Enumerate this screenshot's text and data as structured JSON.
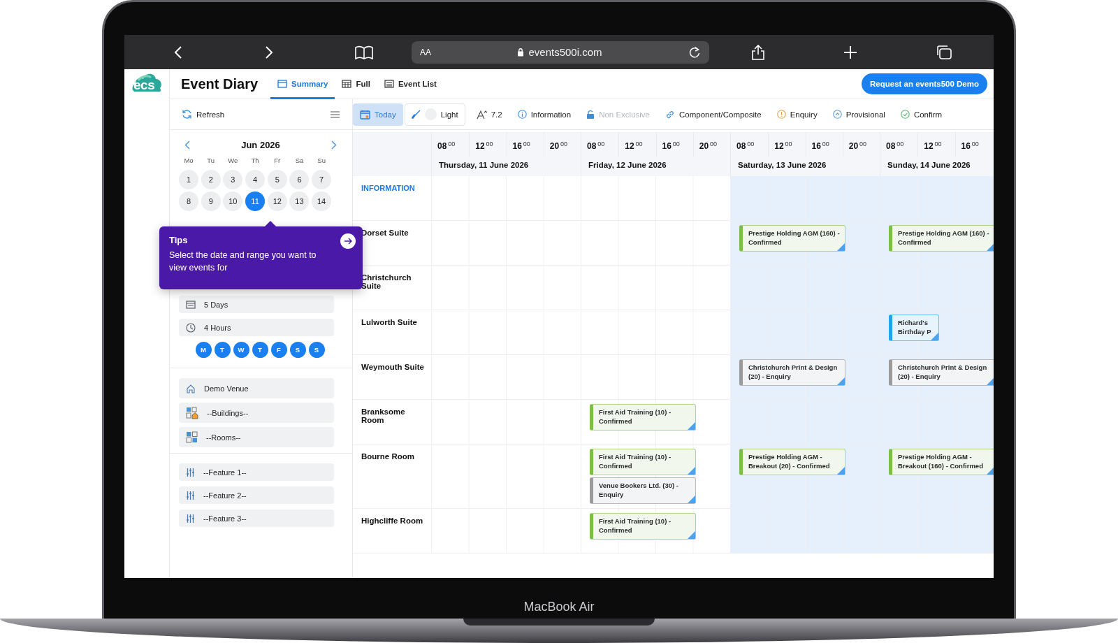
{
  "browser": {
    "text_size": "AA",
    "url": "events500i.com"
  },
  "logo": {
    "text": "ecs"
  },
  "header": {
    "title": "Event Diary",
    "tabs": [
      {
        "label": "Summary",
        "selected": true
      },
      {
        "label": "Full",
        "selected": false
      },
      {
        "label": "Event List",
        "selected": false
      }
    ],
    "demo_button": "Request an events500 Demo"
  },
  "sidebar": {
    "refresh": "Refresh",
    "calendar": {
      "month": "Jun 2026",
      "weekdays": [
        "Mo",
        "Tu",
        "We",
        "Th",
        "Fr",
        "Sa",
        "Su"
      ],
      "days": [
        {
          "label": "1",
          "selected": false
        },
        {
          "label": "2",
          "selected": false
        },
        {
          "label": "3",
          "selected": false
        },
        {
          "label": "4",
          "selected": false
        },
        {
          "label": "5",
          "selected": false
        },
        {
          "label": "6",
          "selected": false
        },
        {
          "label": "7",
          "selected": false
        },
        {
          "label": "8",
          "selected": false
        },
        {
          "label": "9",
          "selected": false
        },
        {
          "label": "10",
          "selected": false
        },
        {
          "label": "11",
          "selected": true
        },
        {
          "label": "12",
          "selected": false
        },
        {
          "label": "13",
          "selected": false
        },
        {
          "label": "14",
          "selected": false
        }
      ]
    },
    "tips": {
      "title": "Tips",
      "text": "Select the date and range you want to view events for"
    },
    "range": [
      {
        "kind": "days",
        "label": "5 Days"
      },
      {
        "kind": "hours",
        "label": "4 Hours"
      }
    ],
    "weekday_filter": [
      {
        "label": "M",
        "selected": true
      },
      {
        "label": "T",
        "selected": true
      },
      {
        "label": "W",
        "selected": true
      },
      {
        "label": "T",
        "selected": true
      },
      {
        "label": "F",
        "selected": true
      },
      {
        "label": "S",
        "selected": true
      },
      {
        "label": "S",
        "selected": true
      }
    ],
    "venue_filters": [
      {
        "kind": "venue",
        "label": "Demo Venue"
      },
      {
        "kind": "buildings",
        "label": "--Buildings--"
      },
      {
        "kind": "rooms",
        "label": "--Rooms--"
      }
    ],
    "feature_filters": [
      {
        "label": "--Feature 1--"
      },
      {
        "label": "--Feature 2--"
      },
      {
        "label": "--Feature 3--"
      }
    ]
  },
  "toolbar": [
    {
      "kind": "today",
      "label": "Today",
      "selected": true,
      "disabled": false
    },
    {
      "kind": "theme",
      "label": "Light",
      "on": false,
      "selected": false,
      "disabled": false
    },
    {
      "kind": "font",
      "label": "7.2",
      "selected": false,
      "disabled": false
    },
    {
      "kind": "information",
      "label": "Information",
      "selected": false,
      "disabled": false
    },
    {
      "kind": "non-exclusive",
      "label": "Non Exclusive",
      "selected": false,
      "disabled": true
    },
    {
      "kind": "component",
      "label": "Component/Composite",
      "selected": false,
      "disabled": false
    },
    {
      "kind": "enquiry",
      "label": "Enquiry",
      "selected": false,
      "disabled": false
    },
    {
      "kind": "provisional",
      "label": "Provisional",
      "selected": false,
      "disabled": false
    },
    {
      "kind": "confirm",
      "label": "Confirm",
      "selected": false,
      "disabled": false
    }
  ],
  "timeline": {
    "days": [
      {
        "date": "Thursday, 11 June 2026",
        "shaded": false,
        "hours": [
          {
            "hour": "08",
            "minutes": "00"
          },
          {
            "hour": "12",
            "minutes": "00"
          },
          {
            "hour": "16",
            "minutes": "00"
          },
          {
            "hour": "20",
            "minutes": "00"
          }
        ]
      },
      {
        "date": "Friday, 12 June 2026",
        "shaded": false,
        "hours": [
          {
            "hour": "08",
            "minutes": "00"
          },
          {
            "hour": "12",
            "minutes": "00"
          },
          {
            "hour": "16",
            "minutes": "00"
          },
          {
            "hour": "20",
            "minutes": "00"
          }
        ]
      },
      {
        "date": "Saturday, 13 June 2026",
        "shaded": true,
        "hours": [
          {
            "hour": "08",
            "minutes": "00"
          },
          {
            "hour": "12",
            "minutes": "00"
          },
          {
            "hour": "16",
            "minutes": "00"
          },
          {
            "hour": "20",
            "minutes": "00"
          }
        ]
      },
      {
        "date": "Sunday, 14 June 2026",
        "shaded": true,
        "hours": [
          {
            "hour": "08",
            "minutes": "00"
          },
          {
            "hour": "12",
            "minutes": "00"
          },
          {
            "hour": "16",
            "minutes": "00"
          }
        ]
      }
    ],
    "rows": [
      {
        "kind": "section",
        "label": "INFORMATION",
        "cells": [
          {},
          {},
          {},
          {}
        ]
      },
      {
        "kind": "room",
        "label": "Dorset Suite",
        "cells": [
          {},
          {},
          {
            "events": [
              {
                "text": "Prestige Holding AGM (160) - Confirmed",
                "kind": "confirmed"
              }
            ]
          },
          {
            "events": [
              {
                "text": "Prestige Holding AGM (160) - Confirmed",
                "kind": "confirmed"
              }
            ]
          }
        ]
      },
      {
        "kind": "room",
        "label": "Christchurch Suite",
        "cells": [
          {},
          {},
          {},
          {}
        ]
      },
      {
        "kind": "room",
        "label": "Lulworth Suite",
        "cells": [
          {},
          {},
          {},
          {
            "events": [
              {
                "text": "Richard's Birthday P",
                "kind": "provisional"
              }
            ]
          }
        ]
      },
      {
        "kind": "room",
        "label": "Weymouth Suite",
        "cells": [
          {},
          {},
          {
            "events": [
              {
                "text": "Christchurch Print & Design (20) - Enquiry",
                "kind": "enquiry"
              }
            ]
          },
          {
            "events": [
              {
                "text": "Christchurch Print & Design (20) - Enquiry",
                "kind": "enquiry"
              }
            ]
          }
        ]
      },
      {
        "kind": "room",
        "label": "Branksome Room",
        "cells": [
          {},
          {
            "events": [
              {
                "text": "First Aid Training (10) - Confirmed",
                "kind": "confirmed"
              }
            ]
          },
          {},
          {}
        ]
      },
      {
        "kind": "room",
        "label": "Bourne Room",
        "cells": [
          {},
          {
            "events": [
              {
                "text": "First Aid Training (10) - Confirmed",
                "kind": "confirmed"
              },
              {
                "text": "Venue Bookers Ltd. (30) - Enquiry",
                "kind": "enquiry"
              }
            ]
          },
          {
            "events": [
              {
                "text": "Prestige Holding AGM - Breakout (20) - Confirmed",
                "kind": "confirmed"
              }
            ]
          },
          {
            "events": [
              {
                "text": "Prestige Holding AGM - Breakout (160) - Confirmed",
                "kind": "confirmed"
              }
            ]
          }
        ]
      },
      {
        "kind": "room",
        "label": "Highcliffe Room",
        "cells": [
          {},
          {
            "events": [
              {
                "text": "First Aid Training (10) - Confirmed",
                "kind": "confirmed"
              }
            ]
          },
          {},
          {}
        ]
      }
    ]
  },
  "device": {
    "label": "MacBook Air"
  }
}
